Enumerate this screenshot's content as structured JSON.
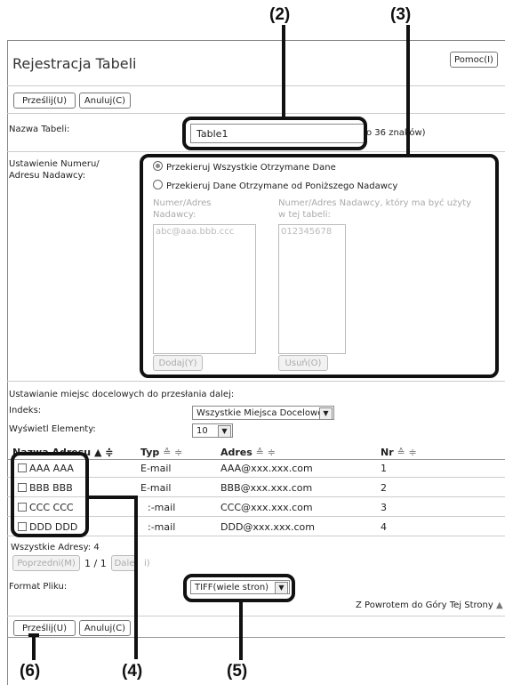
{
  "callouts": {
    "c2": "(2)",
    "c3": "(3)",
    "c4": "(4)",
    "c5": "(5)",
    "c6": "(6)"
  },
  "page": {
    "title": "Rejestracja Tabeli",
    "help_button": "Pomoc(I)",
    "submit_top": "Prześlij(U)",
    "cancel_top": "Anuluj(C)",
    "submit_bottom": "Prześlij(U)",
    "cancel_bottom": "Anuluj(C)"
  },
  "table_name": {
    "label": "Nazwa Tabeli:",
    "value": "Table1",
    "hint": "o 36 znaków)"
  },
  "sender": {
    "label_line1": "Ustawienie Numeru/",
    "label_line2": "Adresu Nadawcy:",
    "option_all": "Przekieruj Wszystkie Otrzymane Dane",
    "option_specific": "Przekieruj Dane Otrzymane od Poniższego Nadawcy",
    "left_caption_line1": "Numer/Adres",
    "left_caption_line2": "Nadawcy:",
    "right_caption_line1": "Numer/Adres Nadawcy, który ma być użyty",
    "right_caption_line2": "w tej tabeli:",
    "left_list_item": "abc@aaa.bbb.ccc",
    "right_list_item": "012345678",
    "add_button": "Dodaj(Y)",
    "delete_button": "Usuń(O)"
  },
  "forward": {
    "heading": "Ustawianie miejsc docelowych do przesłania dalej:",
    "index_label": "Indeks:",
    "index_value": "Wszystkie Miejsca Docelowe",
    "display_label": "Wyświetl Elementy:",
    "display_value": "10"
  },
  "address_table": {
    "headers": [
      "Nazwa Adresu",
      "Typ",
      "Adres",
      "Nr"
    ],
    "rows": [
      {
        "name": "AAA AAA",
        "type": "E-mail",
        "address": "AAA@xxx.xxx.com",
        "nr": "1"
      },
      {
        "name": "BBB BBB",
        "type": "E-mail",
        "address": "BBB@xxx.xxx.com",
        "nr": "2"
      },
      {
        "name": "CCC CCC",
        "type": ":-mail",
        "address": "CCC@xxx.xxx.com",
        "nr": "3"
      },
      {
        "name": "DDD DDD",
        "type": ":-mail",
        "address": "DDD@xxx.xxx.com",
        "nr": "4"
      }
    ],
    "all_addresses_label": "Wszystkie Adresy:",
    "all_addresses_count": "4",
    "prev_button": "Poprzedni(M)",
    "page_indicator": "1 / 1",
    "next_button": "Dale",
    "next_button_tail": "i)"
  },
  "file_format": {
    "label": "Format Pliku:",
    "value": "TIFF(wiele stron)",
    "back_to_top": "Z Powrotem do Góry Tej Strony"
  }
}
